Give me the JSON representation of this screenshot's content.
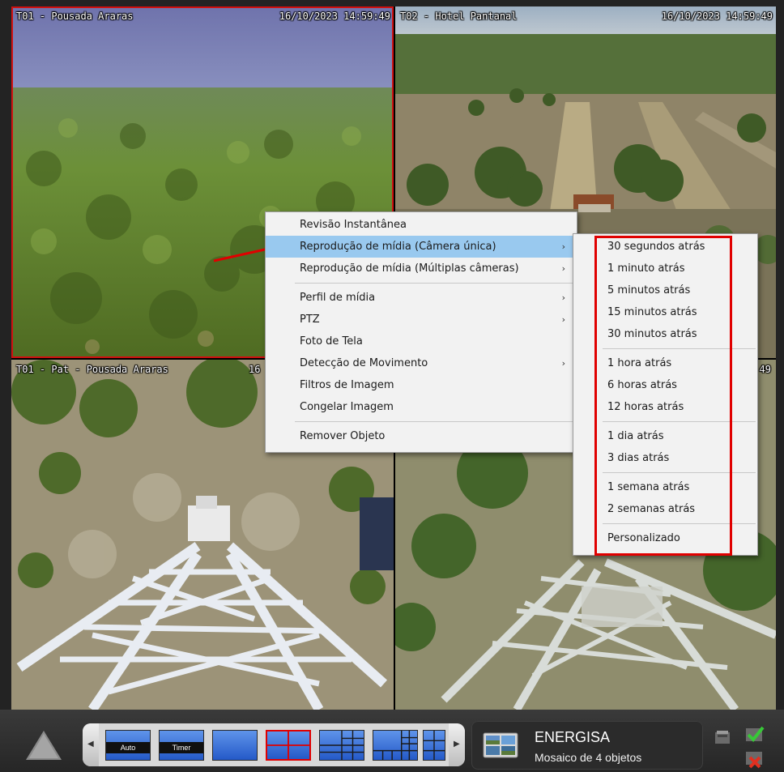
{
  "cameras": [
    {
      "name": "T01 - Pousada Araras",
      "time": "16/10/2023 14:59:49",
      "selected": true
    },
    {
      "name": "T02 - Hotel Pantanal",
      "time": "16/10/2023 14:59:49",
      "selected": false
    },
    {
      "name": "T01 - Pat - Pousada Araras",
      "time": "16",
      "selected": false
    },
    {
      "name": "",
      "time": "49",
      "selected": false
    }
  ],
  "context_menu": {
    "items": [
      {
        "label": "Revisão Instantânea",
        "submenu": false
      },
      {
        "label": "Reprodução de mídia (Câmera única)",
        "submenu": true,
        "highlighted": true
      },
      {
        "label": "Reprodução de mídia (Múltiplas câmeras)",
        "submenu": true
      },
      {
        "label": "Perfil de mídia",
        "submenu": true
      },
      {
        "label": "PTZ",
        "submenu": true
      },
      {
        "label": "Foto de Tela",
        "submenu": false
      },
      {
        "label": "Detecção de Movimento",
        "submenu": true
      },
      {
        "label": "Filtros de Imagem",
        "submenu": false
      },
      {
        "label": "Congelar Imagem",
        "submenu": false
      },
      {
        "label": "Remover Objeto",
        "submenu": false
      }
    ],
    "submenu_arrow": "›"
  },
  "submenu": {
    "groups": [
      [
        "30 segundos atrás",
        "1 minuto atrás",
        "5 minutos atrás",
        "15 minutos atrás",
        "30 minutos atrás"
      ],
      [
        "1 hora atrás",
        "6 horas atrás",
        "12 horas atrás"
      ],
      [
        "1 dia atrás",
        "3 dias atrás"
      ],
      [
        "1 semana atrás",
        "2 semanas atrás"
      ],
      [
        "Personalizado"
      ]
    ]
  },
  "toolbar": {
    "layout_auto_label": "Auto",
    "layout_timer_label": "Timer",
    "nav_left": "◀",
    "nav_right": "▶"
  },
  "info": {
    "title": "ENERGISA",
    "subtitle": "Mosaico de 4 objetos"
  },
  "colors": {
    "highlight": "#99c9ef",
    "selection_border": "#d01010",
    "annotation": "#e00000"
  }
}
